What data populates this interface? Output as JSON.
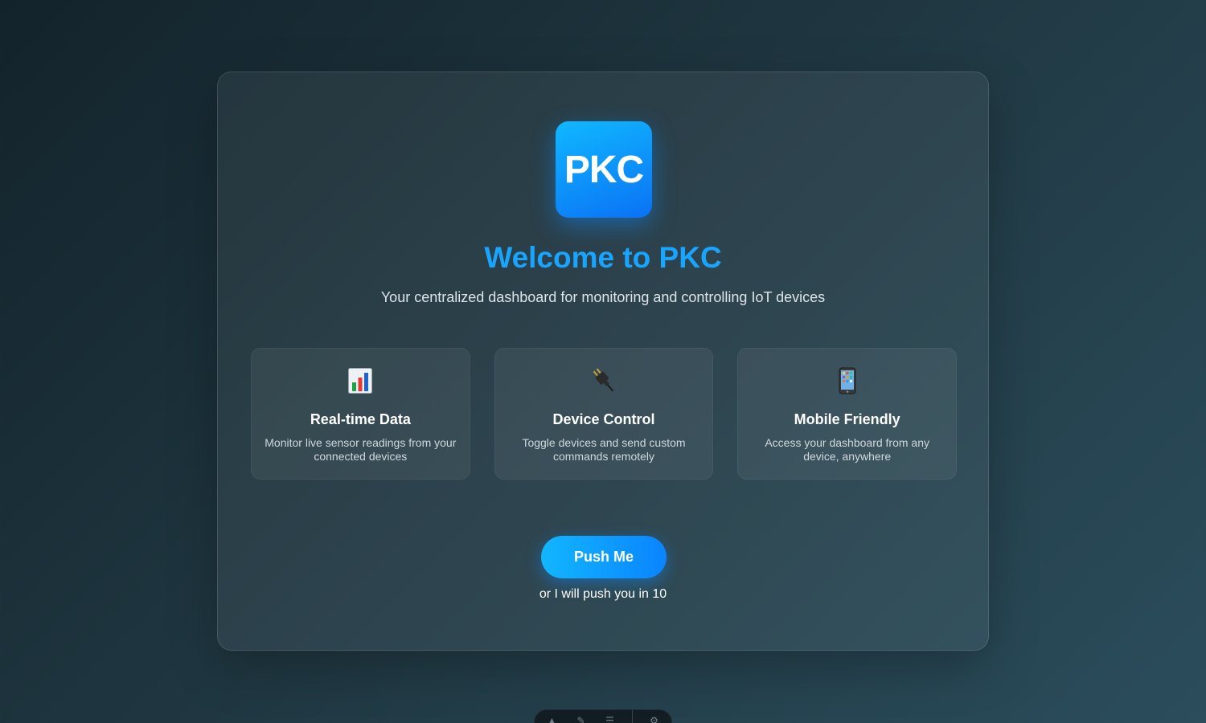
{
  "logo": {
    "text": "PKC"
  },
  "hero": {
    "title": "Welcome to PKC",
    "subtitle": "Your centralized dashboard for monitoring and controlling IoT devices"
  },
  "features": [
    {
      "icon": "bar-chart-icon",
      "title": "Real-time Data",
      "description": "Monitor live sensor readings from your connected devices"
    },
    {
      "icon": "plug-icon",
      "title": "Device Control",
      "description": "Toggle devices and send custom commands remotely"
    },
    {
      "icon": "mobile-phone-icon",
      "title": "Mobile Friendly",
      "description": "Access your dashboard from any device, anywhere"
    }
  ],
  "action": {
    "button_label": "Push Me",
    "countdown_text": "or I will push you in 10"
  },
  "colors": {
    "accent": "#17a5ff",
    "button_gradient_start": "#12b6ff",
    "button_gradient_end": "#0a84ff"
  }
}
